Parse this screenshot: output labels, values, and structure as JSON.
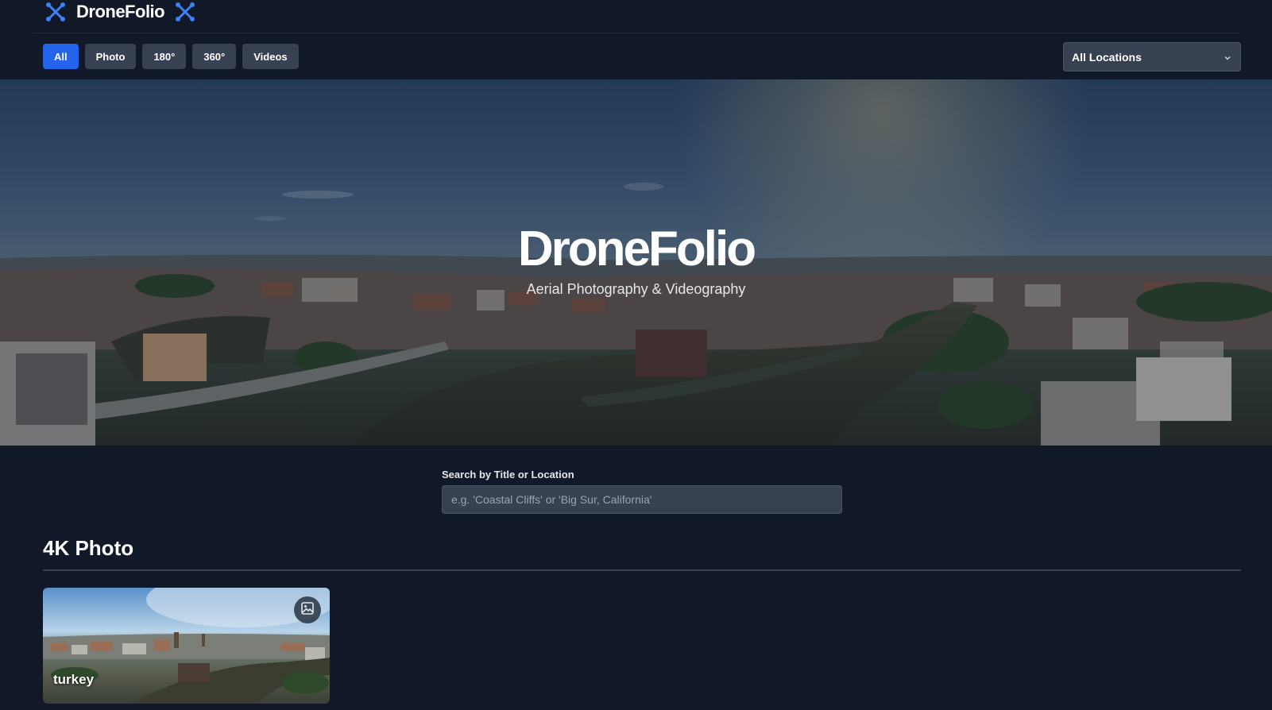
{
  "brand": {
    "name": "DroneFolio",
    "icon": "drone-icon",
    "accent": "#3b82f6"
  },
  "filters": [
    {
      "label": "All",
      "active": true
    },
    {
      "label": "Photo",
      "active": false
    },
    {
      "label": "180°",
      "active": false
    },
    {
      "label": "360°",
      "active": false
    },
    {
      "label": "Videos",
      "active": false
    }
  ],
  "location_select": {
    "value": "All Locations"
  },
  "hero": {
    "title": "DroneFolio",
    "subtitle": "Aerial Photography & Videography"
  },
  "search": {
    "label": "Search by Title or Location",
    "placeholder": "e.g. 'Coastal Cliffs' or 'Big Sur, California'"
  },
  "sections": [
    {
      "title": "4K Photo",
      "items": [
        {
          "title": "turkey",
          "type_icon": "image-icon"
        }
      ]
    }
  ],
  "colors": {
    "background": "#111827",
    "active_filter": "#2563eb",
    "button": "#374151"
  }
}
